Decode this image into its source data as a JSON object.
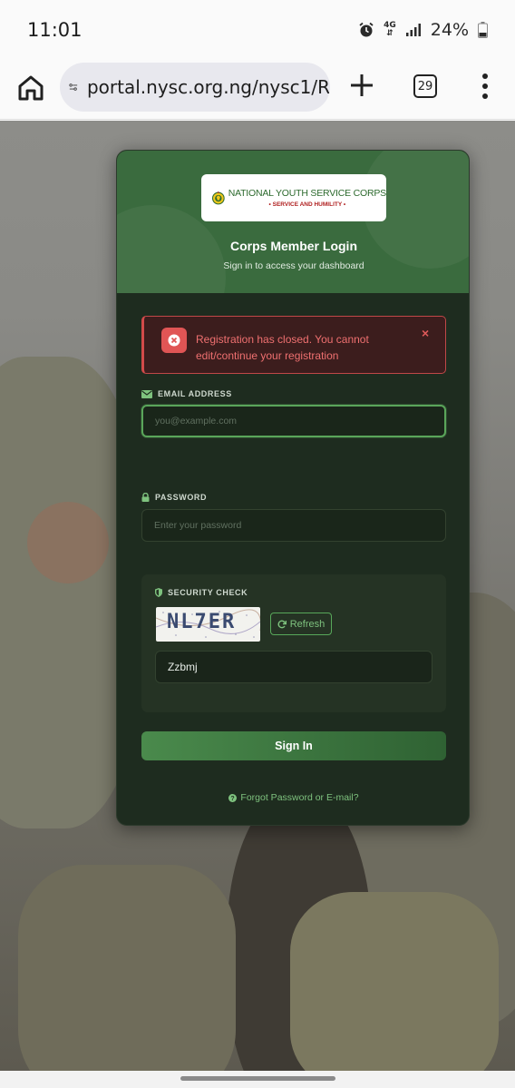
{
  "status_bar": {
    "time": "11:01",
    "network": "4G",
    "battery": "24%"
  },
  "browser": {
    "url": "portal.nysc.org.ng/nysc1/R",
    "tab_count": "29"
  },
  "brand": {
    "logo_title": "NATIONAL YOUTH SERVICE CORPS",
    "logo_motto": "• SERVICE AND HUMILITY •"
  },
  "card": {
    "title": "Corps Member Login",
    "subtitle": "Sign in to access your dashboard"
  },
  "alert": {
    "message": "Registration has closed. You cannot edit/continue your registration",
    "close_symbol": "×"
  },
  "form": {
    "email_label": "EMAIL ADDRESS",
    "email_placeholder": "you@example.com",
    "password_label": "PASSWORD",
    "password_placeholder": "Enter your password",
    "security_label": "SECURITY CHECK",
    "captcha_text": "NL7ER",
    "refresh_label": "Refresh",
    "captcha_value": "Zzbmj",
    "signin_label": "Sign In",
    "forgot_label": "Forgot Password or E-mail?"
  },
  "colors": {
    "header_green": "#3a6b3e",
    "card_dark": "#1e2c1f",
    "alert_red": "#e05555",
    "accent_green": "#7ec27e"
  },
  "icons": [
    "home-icon",
    "site-settings-icon",
    "plus-icon",
    "tabs-icon",
    "more-vert-icon",
    "alarm-icon",
    "signal-icon",
    "battery-icon",
    "error-icon",
    "envelope-icon",
    "lock-icon",
    "shield-icon",
    "refresh-icon",
    "question-icon"
  ]
}
